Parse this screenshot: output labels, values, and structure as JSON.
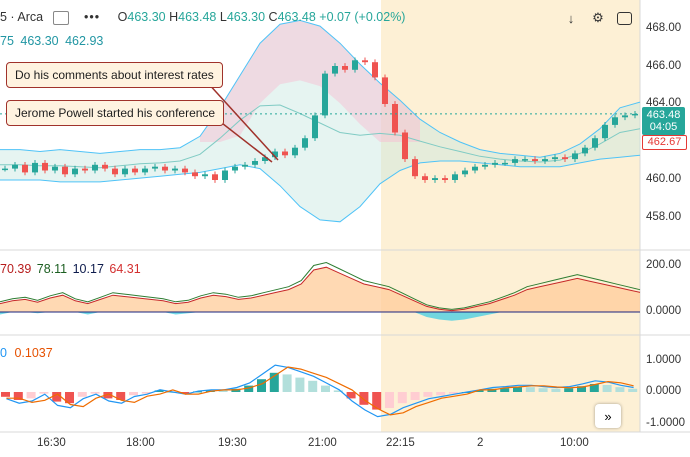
{
  "header": {
    "symbol": "5 · Arca",
    "ohlc": [
      {
        "k": "O",
        "v": "463.30"
      },
      {
        "k": "H",
        "v": "463.48"
      },
      {
        "k": "L",
        "v": "463.30"
      },
      {
        "k": "C",
        "v": "463.48"
      }
    ],
    "change": "+0.07 (+0.02%)",
    "indicator_values": [
      "75",
      "463.30",
      "462.93"
    ],
    "icons": [
      "eye-slash-icon",
      "more-icon",
      "arrow-down-icon",
      "settings-icon",
      "maximize-icon"
    ]
  },
  "annotations": [
    "Do his comments about interest rates",
    "Jerome Powell started his conference"
  ],
  "price_pane": {
    "y_ticks": [
      "468.00",
      "466.00",
      "464.00",
      "462.00",
      "460.00",
      "458.00"
    ],
    "last_price": "463.48",
    "countdown": "04:05",
    "band_price": "462.67",
    "up_color": "#26a69a",
    "down_color": "#ef5350"
  },
  "osc_pane": {
    "legend": [
      {
        "text": "70.39",
        "color": "#b71c1c"
      },
      {
        "text": "78.11",
        "color": "#1b5e20"
      },
      {
        "text": "10.17",
        "color": "#0d1b4c"
      },
      {
        "text": "64.31",
        "color": "#d32f2f"
      }
    ],
    "y_ticks": [
      "200.00",
      "0.0000"
    ]
  },
  "macd_pane": {
    "legend": [
      {
        "text": "0",
        "color": "#2196f3"
      },
      {
        "text": "0.1037",
        "color": "#e65100"
      }
    ],
    "y_ticks": [
      "1.0000",
      "0.0000",
      "-1.0000"
    ]
  },
  "x_axis": [
    "16:30",
    "18:00",
    "19:30",
    "21:00",
    "22:15",
    "2",
    "10:00"
  ],
  "chart_data": {
    "type": "candlestick",
    "x": [
      "16:30",
      "18:00",
      "19:30",
      "21:00",
      "22:15",
      "2",
      "10:00"
    ],
    "ylim": [
      457,
      469
    ],
    "last_price": 463.48,
    "ohlc_last": {
      "open": 463.3,
      "high": 463.48,
      "low": 463.3,
      "close": 463.48
    },
    "change": 0.07,
    "change_pct": 0.02,
    "band_value": 462.67,
    "series": [
      {
        "name": "close",
        "values": [
          460.6,
          460.8,
          460.4,
          460.9,
          460.5,
          460.7,
          460.3,
          460.6,
          460.5,
          460.8,
          460.6,
          460.3,
          460.6,
          460.4,
          460.6,
          460.7,
          460.5,
          460.6,
          460.4,
          460.2,
          460.3,
          460.0,
          460.5,
          460.7,
          460.8,
          461.0,
          461.2,
          461.5,
          461.3,
          461.7,
          462.2,
          463.4,
          465.6,
          466.0,
          465.8,
          466.3,
          466.2,
          465.4,
          464.0,
          462.5,
          461.1,
          460.2,
          460.0,
          460.1,
          460.0,
          460.3,
          460.5,
          460.7,
          460.8,
          460.9,
          460.9,
          461.1,
          461.1,
          461.0,
          461.1,
          461.2,
          461.1,
          461.4,
          461.7,
          462.2,
          462.9,
          463.3,
          463.4,
          463.48
        ]
      },
      {
        "name": "upper_band",
        "values": [
          461.6,
          461.6,
          461.5,
          461.6,
          461.5,
          461.4,
          461.5,
          461.6,
          461.6,
          461.7,
          462.3,
          463.8,
          465.5,
          467.2,
          468.2,
          468.4,
          468.1,
          467.2,
          466.1,
          465.1,
          464.2,
          463.2,
          462.5,
          462.0,
          461.6,
          461.4,
          461.3,
          461.2,
          461.4,
          461.9,
          462.7,
          463.8,
          464.1
        ]
      },
      {
        "name": "lower_band",
        "values": [
          460.0,
          460.0,
          460.0,
          459.9,
          459.9,
          459.9,
          460.0,
          460.1,
          460.2,
          460.3,
          460.4,
          460.6,
          460.8,
          460.6,
          459.7,
          458.6,
          457.9,
          457.8,
          458.6,
          459.8,
          460.5,
          460.9,
          461.0,
          461.0,
          460.9,
          460.8,
          460.7,
          460.7,
          460.7,
          460.9,
          461.1,
          461.2,
          461.3
        ]
      },
      {
        "name": "oscillator",
        "values": [
          30,
          40,
          45,
          35,
          50,
          60,
          40,
          30,
          45,
          60,
          55,
          50,
          45,
          40,
          30,
          35,
          50,
          60,
          55,
          45,
          50,
          60,
          70,
          80,
          100,
          150,
          160,
          140,
          120,
          100,
          90,
          80,
          60,
          40,
          20,
          10,
          5,
          10,
          20,
          30,
          45,
          60,
          80,
          90,
          100,
          110,
          120,
          110,
          100,
          90,
          80,
          70
        ]
      },
      {
        "name": "macd_hist",
        "values": [
          -0.15,
          -0.25,
          -0.2,
          -0.05,
          -0.3,
          -0.35,
          -0.15,
          -0.05,
          -0.2,
          -0.25,
          -0.1,
          -0.05,
          0.05,
          0.0,
          -0.05,
          0.02,
          0.05,
          0.05,
          0.1,
          0.2,
          0.4,
          0.6,
          0.55,
          0.45,
          0.35,
          0.2,
          0.05,
          -0.2,
          -0.4,
          -0.55,
          -0.5,
          -0.35,
          -0.25,
          -0.15,
          -0.1,
          -0.05,
          0.0,
          0.05,
          0.1,
          0.12,
          0.15,
          0.15,
          0.12,
          0.1,
          0.12,
          0.18,
          0.25,
          0.22,
          0.15,
          0.1
        ]
      }
    ]
  }
}
